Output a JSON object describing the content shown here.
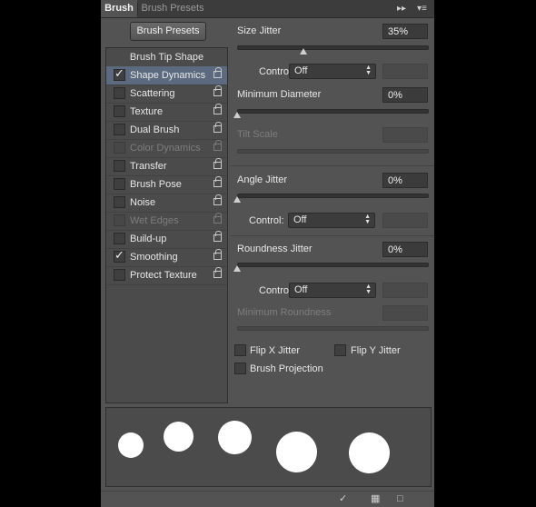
{
  "tabs": {
    "brush": "Brush",
    "brush_presets": "Brush Presets"
  },
  "buttons": {
    "brush_presets": "Brush Presets"
  },
  "left_list": {
    "header": "Brush Tip Shape",
    "items": [
      {
        "label": "Shape Dynamics",
        "checked": true,
        "selected": true,
        "disabled": false
      },
      {
        "label": "Scattering",
        "checked": false,
        "selected": false,
        "disabled": false
      },
      {
        "label": "Texture",
        "checked": false,
        "selected": false,
        "disabled": false
      },
      {
        "label": "Dual Brush",
        "checked": false,
        "selected": false,
        "disabled": false
      },
      {
        "label": "Color Dynamics",
        "checked": false,
        "selected": false,
        "disabled": true
      },
      {
        "label": "Transfer",
        "checked": false,
        "selected": false,
        "disabled": false
      },
      {
        "label": "Brush Pose",
        "checked": false,
        "selected": false,
        "disabled": false
      },
      {
        "label": "Noise",
        "checked": false,
        "selected": false,
        "disabled": false
      },
      {
        "label": "Wet Edges",
        "checked": false,
        "selected": false,
        "disabled": true
      },
      {
        "label": "Build-up",
        "checked": false,
        "selected": false,
        "disabled": false
      },
      {
        "label": "Smoothing",
        "checked": true,
        "selected": false,
        "disabled": false
      },
      {
        "label": "Protect Texture",
        "checked": false,
        "selected": false,
        "disabled": false
      }
    ]
  },
  "settings": {
    "size_jitter": {
      "label": "Size Jitter",
      "value": "35%",
      "level": 0.35
    },
    "control1": {
      "label": "Control:",
      "value": "Off"
    },
    "min_diameter": {
      "label": "Minimum Diameter",
      "value": "0%",
      "level": 0
    },
    "tilt_scale": {
      "label": "Tilt Scale"
    },
    "angle_jitter": {
      "label": "Angle Jitter",
      "value": "0%",
      "level": 0
    },
    "control2": {
      "label": "Control:",
      "value": "Off"
    },
    "roundness_jitter": {
      "label": "Roundness Jitter",
      "value": "0%",
      "level": 0
    },
    "control3": {
      "label": "Control:",
      "value": "Off"
    },
    "min_roundness": {
      "label": "Minimum Roundness"
    },
    "flip_x": {
      "label": "Flip X Jitter",
      "checked": false
    },
    "flip_y": {
      "label": "Flip Y Jitter",
      "checked": false
    },
    "brush_projection": {
      "label": "Brush Projection",
      "checked": false
    }
  },
  "icons": {
    "tab_menu": "double-chevron-right-icon",
    "panel_menu": "panel-menu-icon",
    "toggle_live_tip": "brush-tip-icon",
    "grid": "grid-icon",
    "new_preset": "new-preset-icon"
  },
  "colors": {
    "panel_bg": "#535353",
    "selected_row": "#5b6a7e"
  }
}
